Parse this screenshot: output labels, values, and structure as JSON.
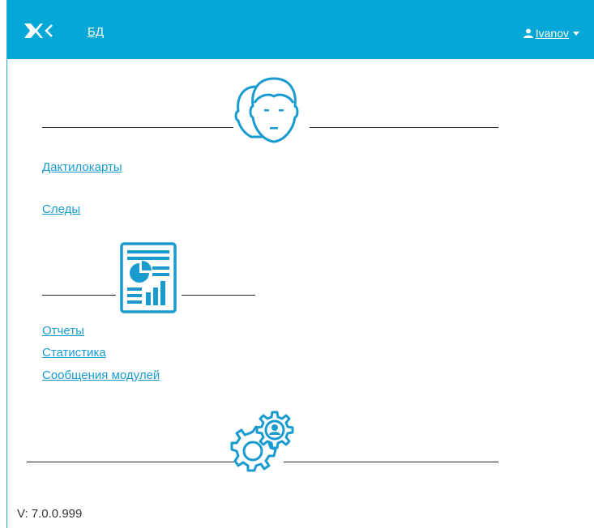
{
  "navbar": {
    "logo_icon": "logo-icon",
    "db_link": "БД",
    "user": {
      "icon": "user-icon",
      "name": "Ivanov",
      "dropdown_icon": "caret-down-icon"
    },
    "background": "#04a7d5"
  },
  "sections": [
    {
      "icon": "faces-icon",
      "links": [
        "Дактилокарты",
        "Следы"
      ]
    },
    {
      "icon": "report-icon",
      "links": [
        "Отчеты",
        "Статистика",
        "Сообщения модулей"
      ]
    },
    {
      "icon": "gears-icon",
      "links": []
    }
  ],
  "footer": {
    "version": "V: 7.0.0.999"
  },
  "colors": {
    "accent": "#04a7d5",
    "link": "#1a9bd0"
  }
}
